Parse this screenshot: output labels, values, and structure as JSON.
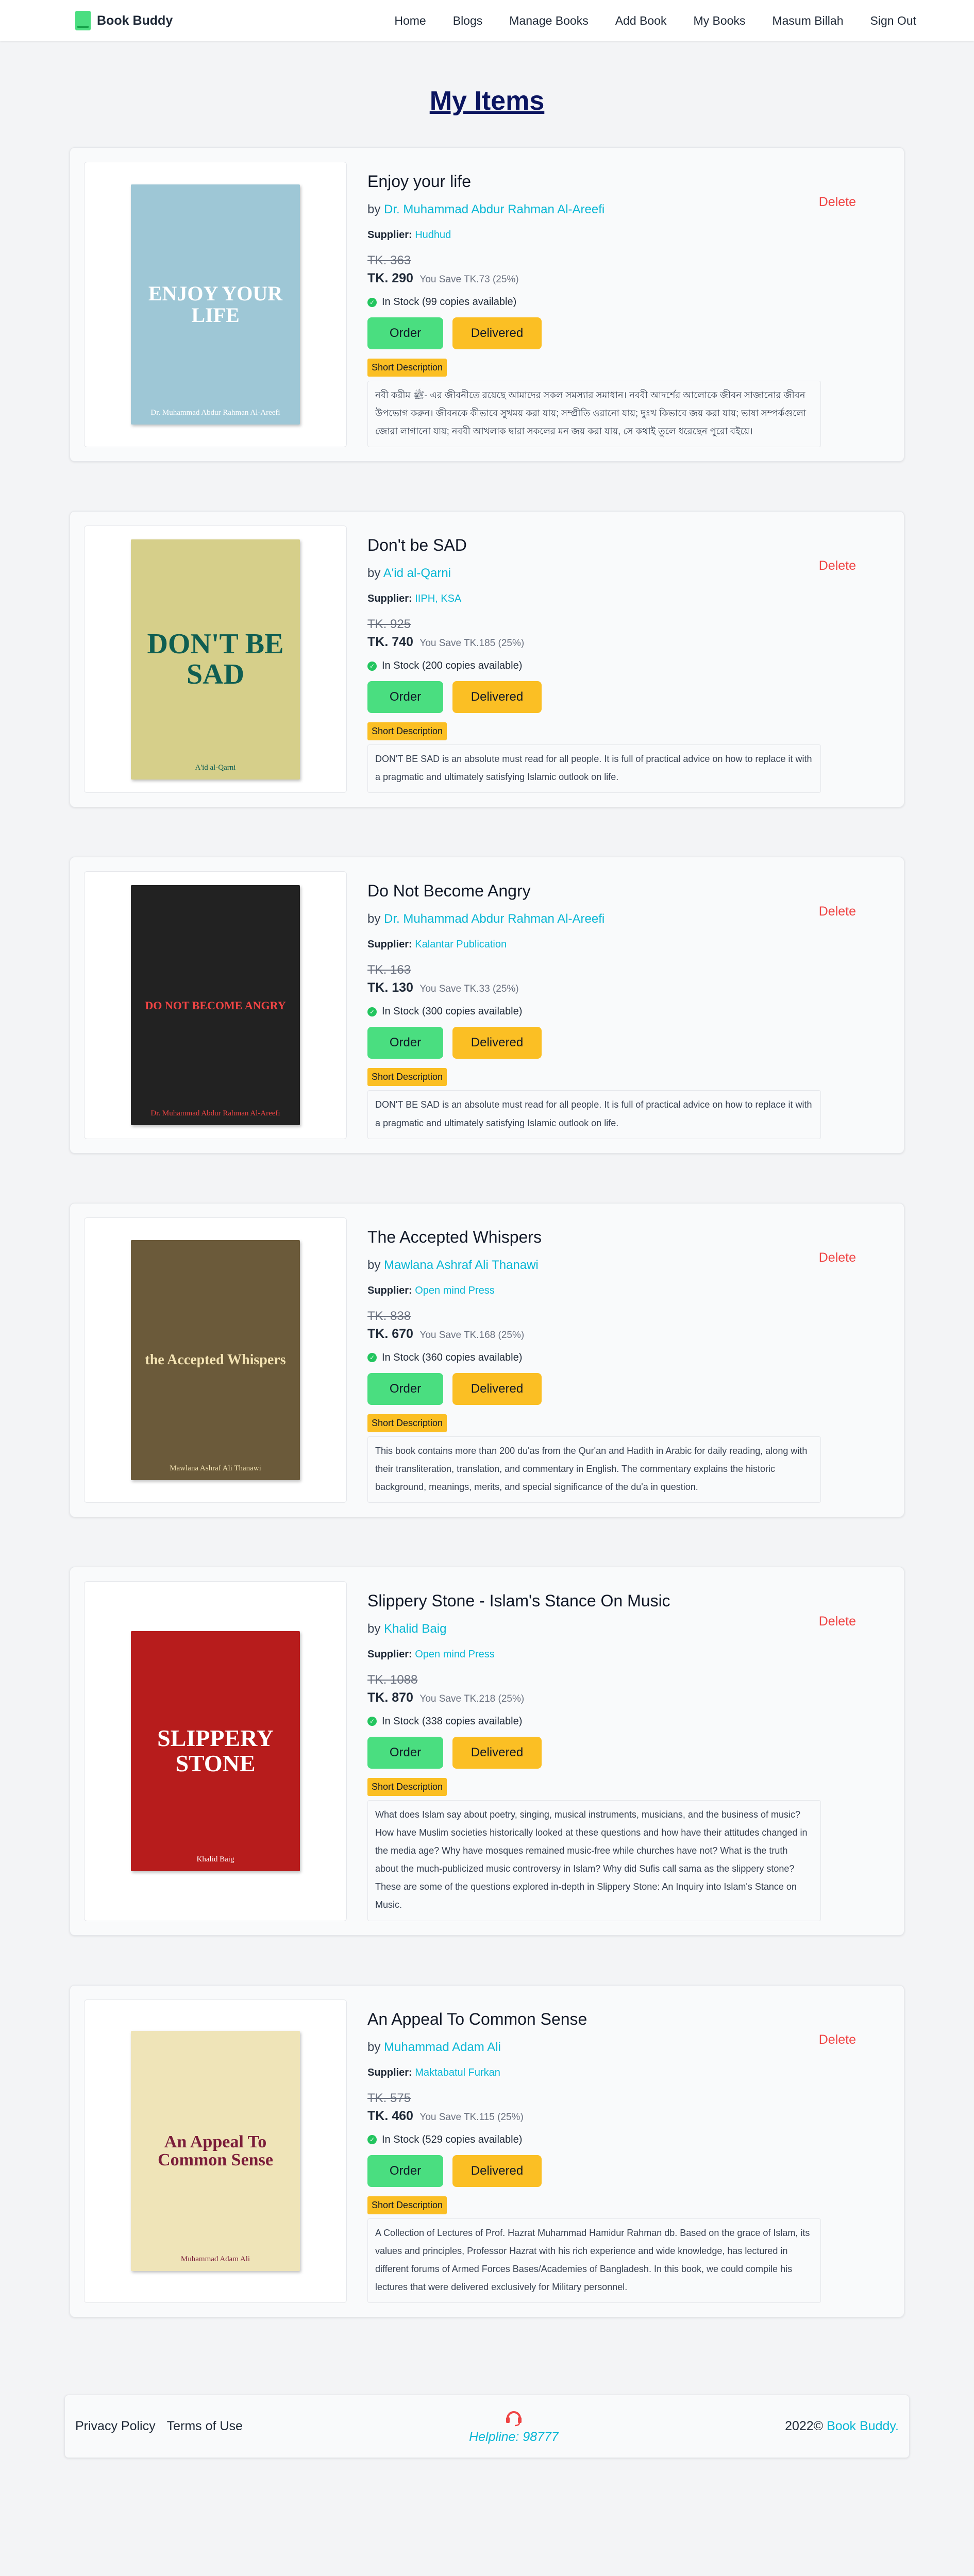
{
  "nav": {
    "brand": "Book Buddy",
    "links": [
      "Home",
      "Blogs",
      "Manage Books",
      "Add Book",
      "My Books",
      "Masum Billah",
      "Sign Out"
    ]
  },
  "page_title": "My Items",
  "labels": {
    "by": "by",
    "supplier": "Supplier:",
    "order": "Order",
    "delivered": "Delivered",
    "short_description": "Short Description",
    "delete": "Delete"
  },
  "items": [
    {
      "title": "Enjoy your life",
      "author": "Dr. Muhammad Abdur Rahman Al-Areefi",
      "supplier": "Hudhud",
      "old_price": "TK. 363",
      "new_price": "TK. 290",
      "save": "You Save TK.73 (25%)",
      "stock": "In Stock (99 copies available)",
      "description": "নবী করীম ﷺ- এর জীবনীতে রয়েছে আমাদের সকল সমস্যার সমাধান। নববী আদর্শের আলোকে জীবন সাজানোর জীবন উপভোগ করুন। জীবনকে কীভাবে সুখময় করা যায়; সম্প্রীতি ওরানো যায়; দুঃখ কিভাবে জয় করা যায়; ভাষা সম্পর্কগুলো জোরা লাগানো যায়; নববী আখলাক দ্বারা সকলের মন জয় করা যায়, সে কথাই তুলে ধরেছেন পুরো বইয়ে।",
      "cover": {
        "title": "ENJOY YOUR LIFE",
        "bg": "#9ec7d6",
        "fg": "#ffffff"
      }
    },
    {
      "title": "Don't be SAD",
      "author": "A'id al-Qarni",
      "supplier": "IIPH, KSA",
      "old_price": "TK. 925",
      "new_price": "TK. 740",
      "save": "You Save TK.185 (25%)",
      "stock": "In Stock (200 copies available)",
      "description": "DON'T BE SAD is an absolute must read for all people. It is full of practical advice on how to replace it with a pragmatic and ultimately satisfying Islamic outlook on life.",
      "cover": {
        "title": "DON'T BE SAD",
        "bg": "#d6cf8a",
        "fg": "#0f5e52"
      }
    },
    {
      "title": "Do Not Become Angry",
      "author": "Dr. Muhammad Abdur Rahman Al-Areefi",
      "supplier": "Kalantar Publication",
      "old_price": "TK. 163",
      "new_price": "TK. 130",
      "save": "You Save TK.33 (25%)",
      "stock": "In Stock (300 copies available)",
      "description": "DON'T BE SAD is an absolute must read for all people. It is full of practical advice on how to replace it with a pragmatic and ultimately satisfying Islamic outlook on life.",
      "cover": {
        "title": "DO NOT BECOME ANGRY",
        "bg": "#222222",
        "fg": "#ef4444"
      }
    },
    {
      "title": "The Accepted Whispers",
      "author": "Mawlana Ashraf Ali Thanawi",
      "supplier": "Open mind Press",
      "old_price": "TK. 838",
      "new_price": "TK. 670",
      "save": "You Save TK.168 (25%)",
      "stock": "In Stock (360 copies available)",
      "description": "This book contains more than 200 du'as from the Qur'an and Hadith in Arabic for daily reading, along with their transliteration, translation, and commentary in English. The commentary explains the historic background, meanings, merits, and special significance of the du'a in question.",
      "cover": {
        "title": "the Accepted Whispers",
        "bg": "#6b5a3a",
        "fg": "#f3e3b3"
      }
    },
    {
      "title": "Slippery Stone - Islam's Stance On Music",
      "author": "Khalid Baig",
      "supplier": "Open mind Press",
      "old_price": "TK. 1088",
      "new_price": "TK. 870",
      "save": "You Save TK.218 (25%)",
      "stock": "In Stock (338 copies available)",
      "description": "What does Islam say about poetry, singing, musical instruments, musicians, and the business of music? How have Muslim societies historically looked at these questions and how have their attitudes changed in the media age? Why have mosques remained music-free while churches have not? What is the truth about the much-publicized music controversy in Islam? Why did Sufis call sama as the slippery stone? These are some of the questions explored in-depth in Slippery Stone: An Inquiry into Islam's Stance on Music.",
      "cover": {
        "title": "SLIPPERY STONE",
        "bg": "#b71c1c",
        "fg": "#ffffff"
      }
    },
    {
      "title": "An Appeal To Common Sense",
      "author": "Muhammad Adam Ali",
      "supplier": "Maktabatul Furkan",
      "old_price": "TK. 575",
      "new_price": "TK. 460",
      "save": "You Save TK.115 (25%)",
      "stock": "In Stock (529 copies available)",
      "description": "A Collection of Lectures of Prof. Hazrat Muhammad Hamidur Rahman db. Based on the grace of Islam, its values and principles, Professor Hazrat with his rich experience and wide knowledge, has lectured in different forums of Armed Forces Bases/Academies of Bangladesh. In this book, we could compile his lectures that were delivered exclusively for Military personnel.",
      "cover": {
        "title": "An Appeal To Common Sense",
        "bg": "#efe4b8",
        "fg": "#7b1d3a"
      }
    }
  ],
  "footer": {
    "privacy": "Privacy Policy",
    "terms": "Terms of Use",
    "helpline": "Helpline: 98777",
    "copyright": "2022©",
    "brand": "Book Buddy."
  },
  "colors": {
    "accent": "#06b6d4",
    "order": "#4ade80",
    "delivered": "#fbbf24",
    "delete": "#ef4444",
    "title": "#0b1560"
  }
}
